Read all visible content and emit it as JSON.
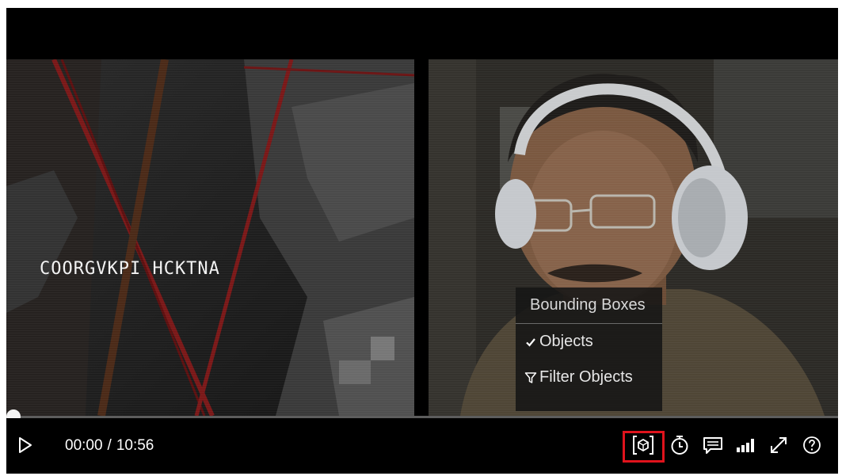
{
  "video": {
    "overlay_text": "COORGVKPI HCKTNA"
  },
  "menu": {
    "header": "Bounding Boxes",
    "items": [
      {
        "label": "Objects",
        "icon": "check-icon",
        "checked": true
      },
      {
        "label": "Filter Objects",
        "icon": "filter-icon",
        "checked": false
      }
    ]
  },
  "playback": {
    "current_time": "00:00",
    "separator": "/",
    "duration": "10:56",
    "progress": 0
  },
  "controls": {
    "icons": [
      "play-icon",
      "bounding-box-icon",
      "timer-icon",
      "captions-icon",
      "quality-icon",
      "fullscreen-icon",
      "help-icon"
    ],
    "highlight_color": "#e0131c"
  }
}
